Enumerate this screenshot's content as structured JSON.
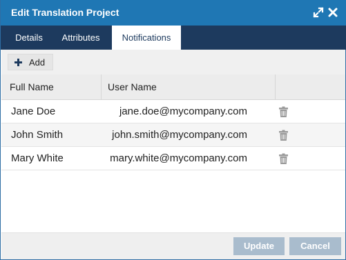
{
  "dialog": {
    "title": "Edit Translation Project",
    "icons": {
      "expand": "expand-icon",
      "close": "close-icon"
    }
  },
  "tabs": [
    {
      "label": "Details",
      "active": false
    },
    {
      "label": "Attributes",
      "active": false
    },
    {
      "label": "Notifications",
      "active": true
    }
  ],
  "toolbar": {
    "add_label": "Add",
    "add_icon": "plus-icon"
  },
  "grid": {
    "columns": [
      "Full Name",
      "User Name"
    ],
    "rows": [
      {
        "full_name": "Jane Doe",
        "user_name": "jane.doe@mycompany.com"
      },
      {
        "full_name": "John Smith",
        "user_name": "john.smith@mycompany.com"
      },
      {
        "full_name": "Mary White",
        "user_name": "mary.white@mycompany.com"
      }
    ],
    "row_action_icon": "trash-icon"
  },
  "footer": {
    "update_label": "Update",
    "cancel_label": "Cancel"
  },
  "colors": {
    "titlebar": "#1f77b4",
    "tabbar": "#1d3a5e",
    "disabled_button": "#a9bccd"
  }
}
